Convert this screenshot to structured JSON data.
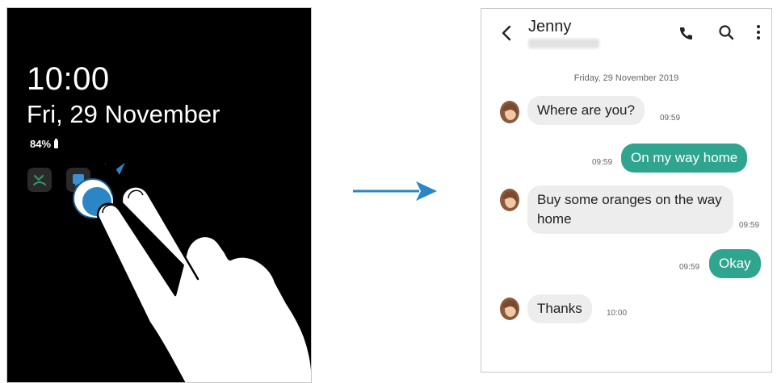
{
  "aod": {
    "time": "10:00",
    "date": "Fri, 29 November",
    "battery": "84%",
    "notifications": [
      {
        "icon": "missed-call-icon",
        "color": "#2f9e6a"
      },
      {
        "icon": "message-icon",
        "color": "#3b8fd3"
      }
    ]
  },
  "conversation": {
    "contact_name": "Jenny",
    "date_header": "Friday, 29 November 2019",
    "messages": [
      {
        "direction": "in",
        "text": "Where are you?",
        "time": "09:59"
      },
      {
        "direction": "out",
        "text": "On my way home",
        "time": "09:59"
      },
      {
        "direction": "in",
        "text": "Buy some oranges on the way home",
        "time": "09:59"
      },
      {
        "direction": "out",
        "text": "Okay",
        "time": "09:59"
      },
      {
        "direction": "in",
        "text": "Thanks",
        "time": "10:00"
      }
    ]
  },
  "colors": {
    "outgoing_bubble": "#2fa58f",
    "incoming_bubble": "#ededed",
    "arrow": "#2b86c5"
  }
}
